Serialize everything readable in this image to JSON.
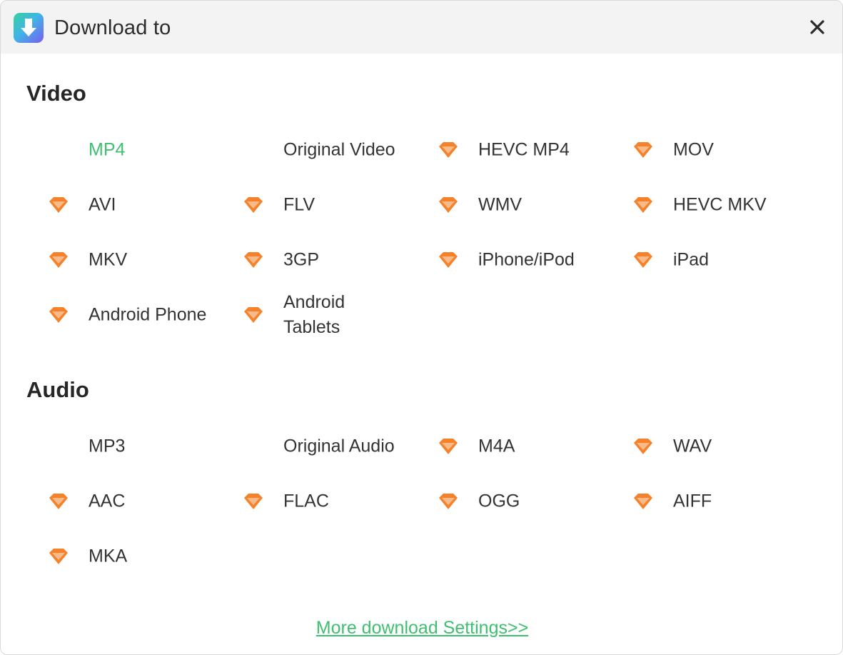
{
  "window": {
    "title": "Download to",
    "app_icon": "download-app-icon",
    "close_icon": "close-icon"
  },
  "sections": [
    {
      "heading": "Video",
      "options": [
        {
          "label": "MP4",
          "premium": false,
          "selected": true
        },
        {
          "label": "Original Video",
          "premium": false,
          "selected": false
        },
        {
          "label": "HEVC MP4",
          "premium": true,
          "selected": false
        },
        {
          "label": "MOV",
          "premium": true,
          "selected": false
        },
        {
          "label": "AVI",
          "premium": true,
          "selected": false
        },
        {
          "label": "FLV",
          "premium": true,
          "selected": false
        },
        {
          "label": "WMV",
          "premium": true,
          "selected": false
        },
        {
          "label": "HEVC MKV",
          "premium": true,
          "selected": false
        },
        {
          "label": "MKV",
          "premium": true,
          "selected": false
        },
        {
          "label": "3GP",
          "premium": true,
          "selected": false
        },
        {
          "label": "iPhone/iPod",
          "premium": true,
          "selected": false
        },
        {
          "label": "iPad",
          "premium": true,
          "selected": false
        },
        {
          "label": "Android Phone",
          "premium": true,
          "selected": false
        },
        {
          "label": "Android Tablets",
          "premium": true,
          "selected": false
        }
      ]
    },
    {
      "heading": "Audio",
      "options": [
        {
          "label": "MP3",
          "premium": false,
          "selected": false
        },
        {
          "label": "Original Audio",
          "premium": false,
          "selected": false
        },
        {
          "label": "M4A",
          "premium": true,
          "selected": false
        },
        {
          "label": "WAV",
          "premium": true,
          "selected": false
        },
        {
          "label": "AAC",
          "premium": true,
          "selected": false
        },
        {
          "label": "FLAC",
          "premium": true,
          "selected": false
        },
        {
          "label": "OGG",
          "premium": true,
          "selected": false
        },
        {
          "label": "AIFF",
          "premium": true,
          "selected": false
        },
        {
          "label": "MKA",
          "premium": true,
          "selected": false
        }
      ]
    }
  ],
  "footer": {
    "more_settings_label": "More download Settings>>"
  },
  "colors": {
    "selected_text": "#3fbf6f",
    "premium_gem": "#f5822a",
    "link": "#3fbf6f"
  }
}
